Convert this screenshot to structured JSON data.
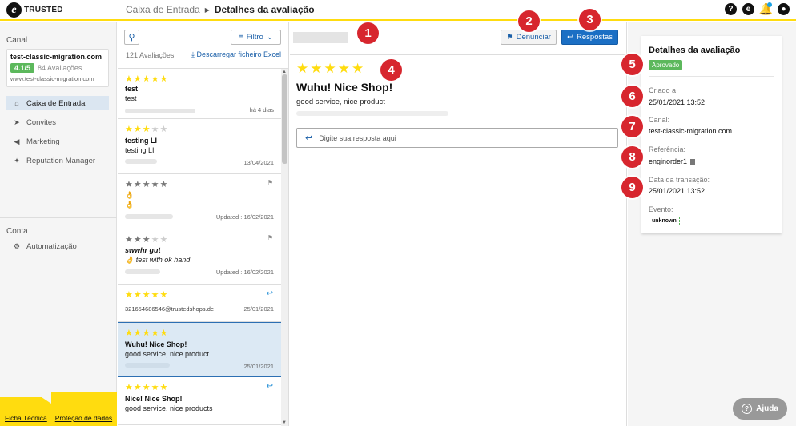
{
  "header": {
    "brand": "TRUSTED",
    "breadcrumb": [
      "Caixa de Entrada",
      "Detalhes da avaliação"
    ],
    "icons": [
      "help-icon",
      "trusted-logo-icon",
      "bell-icon",
      "user-icon"
    ]
  },
  "sidebar": {
    "channel_label": "Canal",
    "channel": {
      "name": "test-classic-migration.com",
      "rating": "4.1/5",
      "reviews": "84 Avaliações",
      "url": "www.test-classic-migration.com"
    },
    "nav": [
      {
        "label": "Caixa de Entrada",
        "icon": "inbox-icon",
        "active": true
      },
      {
        "label": "Convites",
        "icon": "send-icon"
      },
      {
        "label": "Marketing",
        "icon": "megaphone-icon"
      },
      {
        "label": "Reputation Manager",
        "icon": "sparkle-icon"
      }
    ],
    "account_label": "Conta",
    "account_nav": [
      {
        "label": "Automatização",
        "icon": "gear-icon"
      }
    ],
    "footer_links": [
      "Ficha Técnica",
      "Proteção de dados"
    ]
  },
  "list": {
    "filter_label": "Filtro",
    "count": "121 Avaliações",
    "download": "Descarregar ficheiro Excel",
    "reviews": [
      {
        "stars": 5,
        "title": "test",
        "body": "test",
        "date": "há 4 dias"
      },
      {
        "stars": 3,
        "title": "testing LI",
        "body": "testing LI",
        "date": "13/04/2021"
      },
      {
        "stars": 5,
        "title": "👌",
        "body": "👌",
        "date": "Updated : 16/02/2021",
        "flag": true,
        "grey": true
      },
      {
        "stars": 3,
        "title": "swwhr gut",
        "body": "👌 test with ok hand",
        "date": "Updated : 16/02/2021",
        "flag": true,
        "grey": true
      },
      {
        "stars": 5,
        "title": "",
        "body": "321654686546@trustedshops.de",
        "date": "25/01/2021",
        "reply": true
      },
      {
        "stars": 5,
        "title": "Wuhu! Nice Shop!",
        "body": "good service, nice product",
        "date": "25/01/2021",
        "selected": true
      },
      {
        "stars": 5,
        "title": "Nice! Nice Shop!",
        "body": "good service, nice products",
        "date": "25/01/2021",
        "reply": true
      }
    ]
  },
  "detail": {
    "report_label": "Denunciar",
    "reply_label": "Respostas",
    "stars": 5,
    "title": "Wuhu! Nice Shop!",
    "body": "good service, nice product",
    "reply_placeholder": "Digite sua resposta aqui"
  },
  "info": {
    "title": "Detalhes da avaliação",
    "status": "Aprovado",
    "created_label": "Criado a",
    "created": "25/01/2021 13:52",
    "channel_label": "Canal:",
    "channel": "test-classic-migration.com",
    "reference_label": "Referência:",
    "reference": "enginorder1",
    "transaction_label": "Data da transação:",
    "transaction": "25/01/2021 13:52",
    "event_label": "Evento:",
    "event": "unknown"
  },
  "help_label": "Ajuda",
  "callouts": [
    "1",
    "2",
    "3",
    "4",
    "5",
    "6",
    "7",
    "8",
    "9"
  ],
  "colors": {
    "brand_yellow": "#ffdc0f",
    "primary_blue": "#1b6fc4",
    "approved_green": "#5cb85c",
    "callout_red": "#d7262e"
  }
}
